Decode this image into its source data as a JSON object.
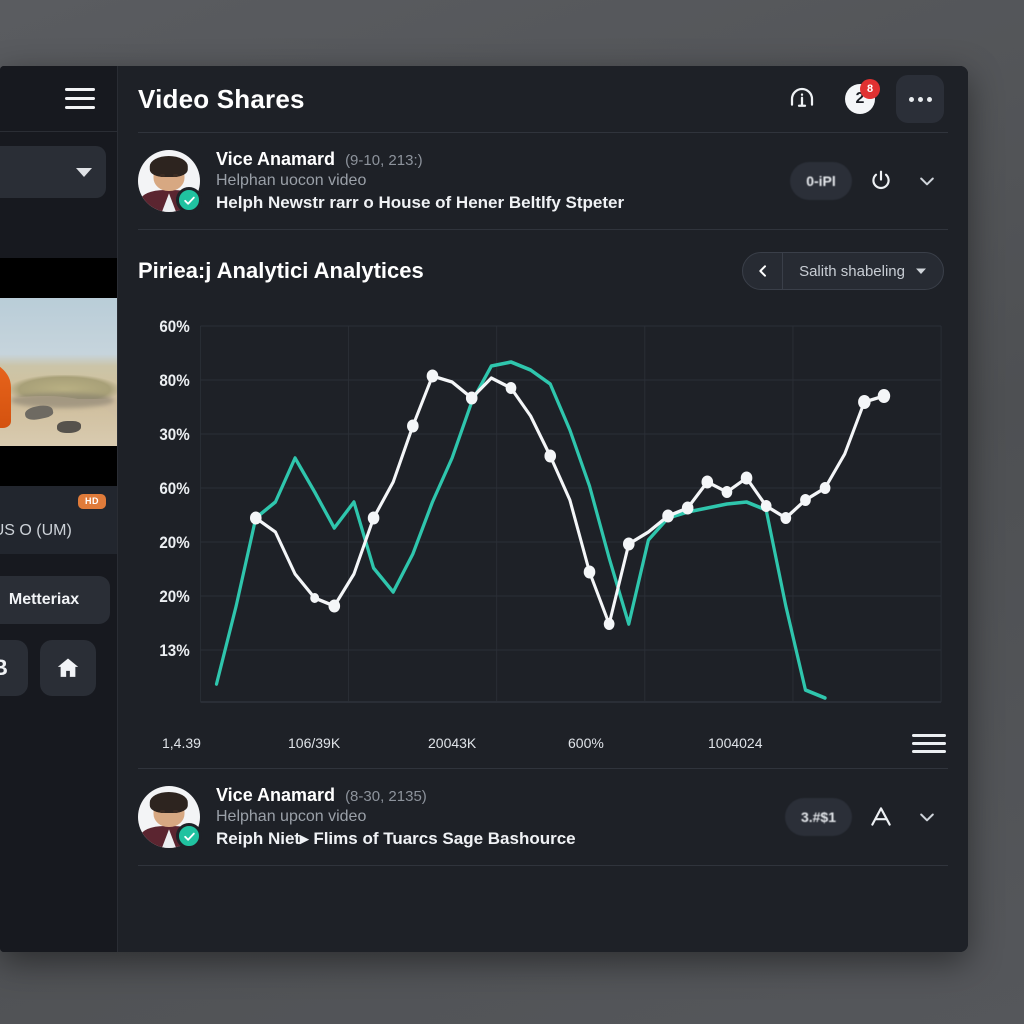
{
  "window": {
    "title": "Video Shares"
  },
  "rail": {
    "menu_icon": "hamburger-icon",
    "dropdown_caret": "chevron-down-icon",
    "video_badge": "HD",
    "caption": "the US O (UM)",
    "primary_button": "Metteriax",
    "icon_buttons": [
      {
        "label": "B",
        "icon": "letter-b-icon"
      },
      {
        "label": "",
        "icon": "home-icon"
      }
    ]
  },
  "topbar": {
    "info_icon": "info-circle-icon",
    "notification_count": "2",
    "notification_badge": "8",
    "more_icon": "more-horizontal-icon"
  },
  "share_top": {
    "name": "Vice Anamard",
    "meta": "(9-10, 213:)",
    "subtitle": "Helphan uocon video",
    "title": "Helph Newstr rarr o House of Hener Beltlfy Stpeter",
    "pill_label": "0-iPl",
    "action_icon": "power-icon",
    "chevron_icon": "chevron-down-icon",
    "verified_icon": "verified-check-icon"
  },
  "share_bottom": {
    "name": "Vice Anamard",
    "meta": "(8-30, 2135)",
    "subtitle": "Helphan upcon video",
    "title": "Reiph Niet▸ Flims of Tuarcs Sage Bashource",
    "pill_label": "3.#$1",
    "action_icon": "font-size-icon",
    "chevron_icon": "chevron-down-icon",
    "verified_icon": "verified-check-icon"
  },
  "analytics": {
    "title": "Piriea:j Analytici Analytices",
    "back_icon": "chevron-left-icon",
    "selector_label": "Salith shabeling",
    "selector_caret": "caret-down-icon",
    "footer_menu_icon": "hamburger-icon"
  },
  "colors": {
    "accent_teal": "#2fc6ad",
    "series_white": "#f4f6f8",
    "panel": "#1e2127",
    "rail": "#17191f",
    "badge_red": "#e03131",
    "badge_orange": "#e07b3a",
    "verified_green": "#20c2a0"
  },
  "chart_data": {
    "type": "line",
    "title": "Piriea:j Analytici Analytices",
    "xlabel": "",
    "ylabel": "",
    "grid": true,
    "legend": "none",
    "ytick_labels": [
      "60%",
      "80%",
      "30%",
      "60%",
      "20%",
      "20%",
      "13%"
    ],
    "xtick_labels": [
      "1,4.39",
      "106/39K",
      "20043K",
      "600%",
      "1004024"
    ],
    "x": [
      0,
      1,
      2,
      3,
      4,
      5,
      6,
      7,
      8,
      9,
      10,
      11,
      12,
      13,
      14,
      15,
      16,
      17,
      18,
      19,
      20,
      21,
      22,
      23,
      24,
      25,
      26,
      27,
      28,
      29,
      30
    ],
    "series": [
      {
        "name": "teal-series",
        "color": "#2fc6ad",
        "markers": false,
        "values": [
          4,
          29,
          34,
          26,
          46,
          38,
          28,
          26,
          21,
          18,
          27,
          41,
          55,
          72,
          84,
          86,
          83,
          82,
          79,
          74,
          66,
          44,
          28,
          52,
          57,
          58,
          62,
          63,
          64,
          40,
          6
        ]
      },
      {
        "name": "white-series",
        "color": "#f4f6f8",
        "markers": true,
        "values": [
          null,
          null,
          34,
          38,
          32,
          25,
          16,
          14,
          13,
          22,
          30,
          42,
          55,
          72,
          88,
          87,
          85,
          80,
          74,
          60,
          46,
          12,
          57,
          60,
          52,
          58,
          71,
          70,
          66,
          68,
          72,
          80,
          88
        ],
        "marker_values": [
          35,
          17,
          14,
          23,
          31,
          56,
          72,
          88,
          86,
          80,
          60,
          46,
          12,
          58,
          70,
          66,
          58,
          70,
          65,
          72,
          88
        ]
      }
    ]
  }
}
